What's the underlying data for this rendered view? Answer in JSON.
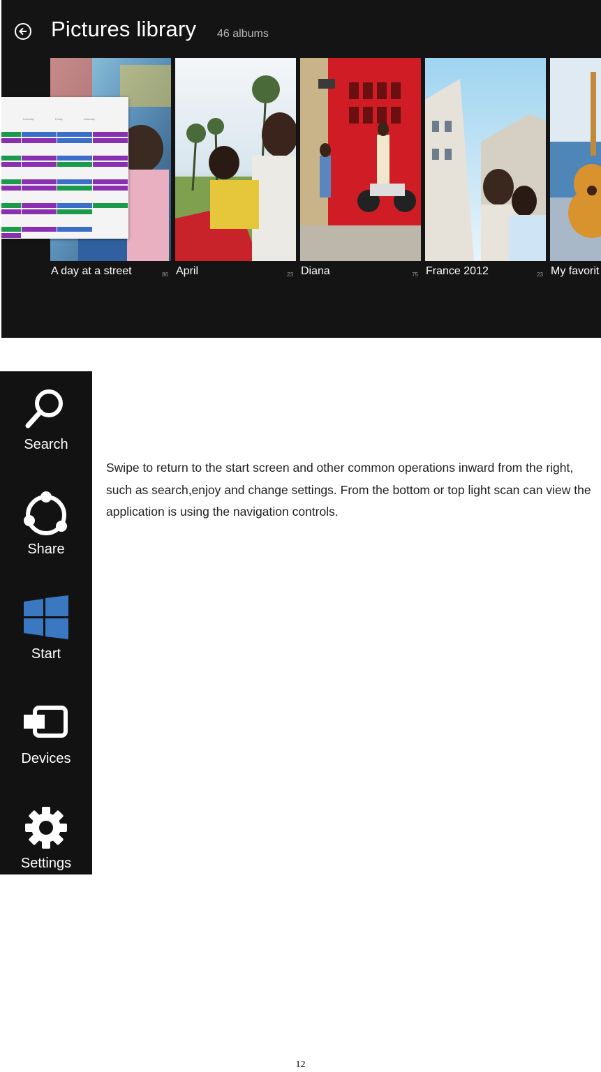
{
  "library": {
    "title": "Pictures library",
    "count": "46 albums",
    "albums": [
      {
        "name": "A day at a street",
        "count": "86"
      },
      {
        "name": "April",
        "count": "23"
      },
      {
        "name": "Diana",
        "count": "75"
      },
      {
        "name": "France 2012",
        "count": "23"
      },
      {
        "name": "My favorit",
        "count": ""
      }
    ],
    "calendar_days": [
      "Thursday",
      "Friday",
      "Saturday"
    ]
  },
  "charms": [
    {
      "label": "Search",
      "icon": "search-icon"
    },
    {
      "label": "Share",
      "icon": "share-icon"
    },
    {
      "label": "Start",
      "icon": "windows-start-icon"
    },
    {
      "label": "Devices",
      "icon": "devices-icon"
    },
    {
      "label": "Settings",
      "icon": "gear-icon"
    }
  ],
  "description": "Swipe to return to the start screen and other common operations inward from the right, such as search,enjoy and change settings. From the bottom or top light scan can view the application is using the navigation controls.",
  "page_number": "12",
  "colors": {
    "screen_bg": "#141414",
    "charms_bg": "#121212",
    "windows_blue": "#3a78c2",
    "event_green": "#1a9a4a",
    "event_purple": "#8a2fb0",
    "event_blue": "#3b6ec9"
  }
}
